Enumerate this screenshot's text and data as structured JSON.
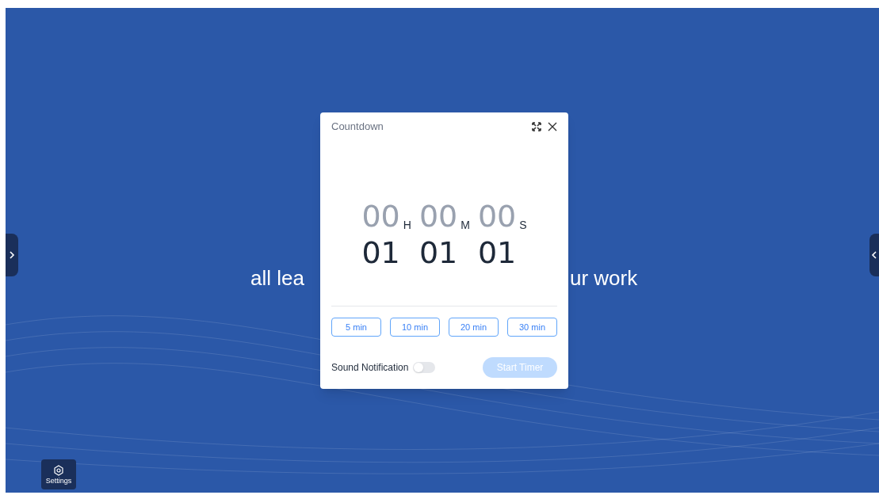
{
  "background_text": {
    "left": "all lea",
    "right": "ur work"
  },
  "settings_button": {
    "label": "Settings"
  },
  "dialog": {
    "title": "Countdown",
    "time_columns": [
      {
        "values": [
          "00",
          "01"
        ],
        "unit": "H"
      },
      {
        "values": [
          "00",
          "01"
        ],
        "unit": "M"
      },
      {
        "values": [
          "00",
          "01"
        ],
        "unit": "S"
      }
    ],
    "presets": [
      "5 min",
      "10 min",
      "20 min",
      "30 min"
    ],
    "sound_notification": {
      "label": "Sound Notification",
      "on": false
    },
    "start_button": {
      "label": "Start Timer",
      "disabled": true
    }
  }
}
